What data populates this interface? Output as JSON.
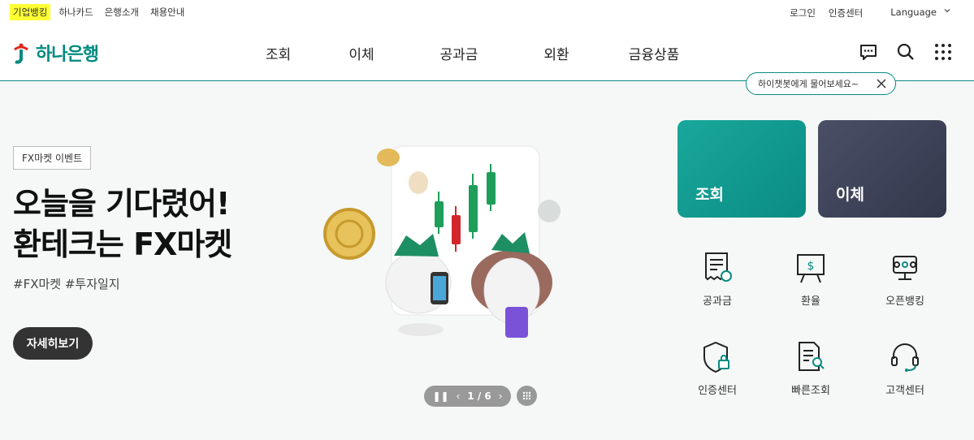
{
  "topbar": {
    "links": [
      "기업뱅킹",
      "하나카드",
      "은행소개",
      "채용안내"
    ],
    "login": "로그인",
    "cert": "인증센터",
    "language": "Language"
  },
  "header": {
    "logo_text": "하나은행",
    "menu": [
      "조회",
      "이체",
      "공과금",
      "외환",
      "금융상품"
    ],
    "chatbot_tip": "하이챗봇에게 물어보세요~"
  },
  "hero": {
    "tag": "FX마켓 이벤트",
    "title_line1": "오늘을 기다렸어!",
    "title_line2": "환테크는 FX마켓",
    "hashtags": "#FX마켓 #투자일지",
    "detail_button": "자세히보기",
    "pager": "1 / 6"
  },
  "quick": {
    "tiles": [
      "조회",
      "이체"
    ],
    "menu": [
      "공과금",
      "환율",
      "오픈뱅킹",
      "인증센터",
      "빠른조회",
      "고객센터"
    ]
  },
  "colors": {
    "brand": "#008a80",
    "tile_dark": "#3a3e54",
    "highlight": "#ffff33"
  }
}
